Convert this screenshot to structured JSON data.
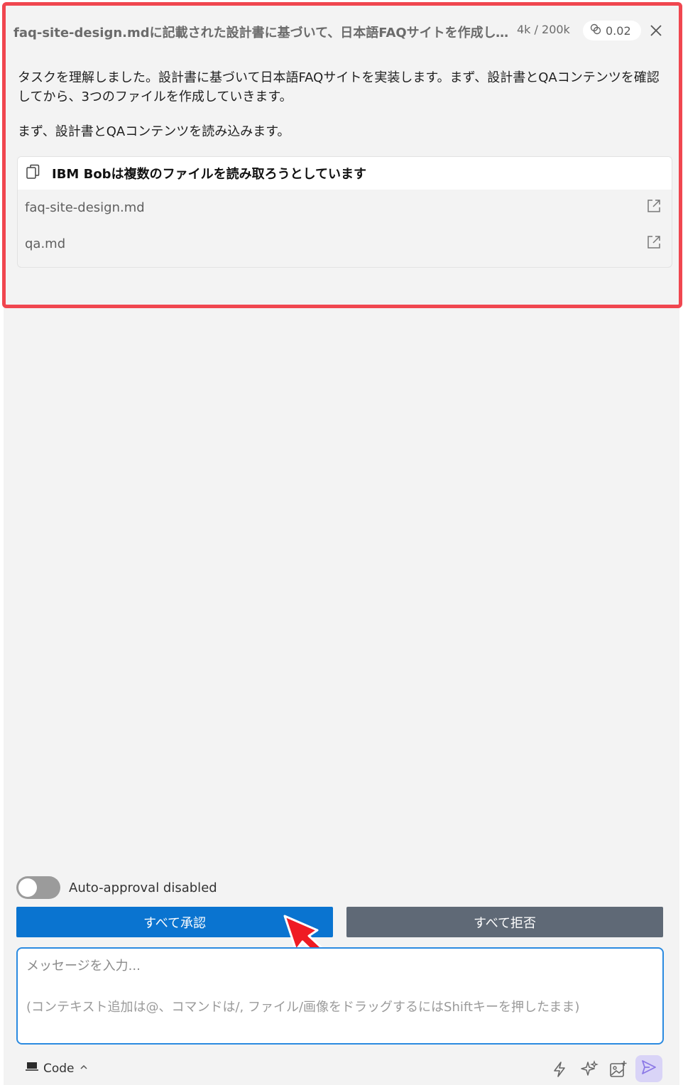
{
  "header": {
    "task_title": "faq-site-design.mdに記載された設計書に基づいて、日本語FAQサイトを作成してください",
    "token_count": "4k / 200k",
    "cost": "0.02"
  },
  "messages": [
    "タスクを理解しました。設計書に基づいて日本語FAQサイトを実装します。まず、設計書とQAコンテンツを確認してから、3つのファイルを作成していきます。",
    "まず、設計書とQAコンテンツを読み込みます。"
  ],
  "file_card": {
    "title": "IBM Bobは複数のファイルを読み取ろうとしています",
    "files": [
      "faq-site-design.md",
      "qa.md"
    ]
  },
  "controls": {
    "auto_approval_label": "Auto-approval disabled",
    "approve_all": "すべて承認",
    "reject_all": "すべて拒否"
  },
  "input": {
    "placeholder": "メッセージを入力...",
    "hint": "(コンテキスト追加は@、コマンドは/, ファイル/画像をドラッグするにはShiftキーを押したまま)"
  },
  "footer": {
    "mode": "Code"
  },
  "colors": {
    "highlight": "#f0464f",
    "approve": "#0a74d0",
    "reject": "#5f6976",
    "input_border": "#2a8ae0"
  }
}
